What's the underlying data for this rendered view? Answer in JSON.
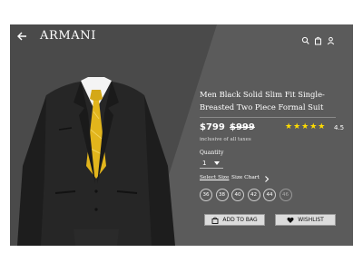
{
  "app": {
    "brand": "ARMANI",
    "icons": [
      "back-arrow-icon",
      "search-icon",
      "bag-icon",
      "user-icon"
    ]
  },
  "product": {
    "title": "Men Black Solid Slim Fit Single-Breasted Two Piece Formal Suit",
    "price": "$799",
    "mrp": "$999",
    "stars": "★★★★★",
    "rating": "4.5",
    "tax_note": "inclusive of all taxes",
    "quantity_label": "Quantity",
    "quantity_value": "1",
    "select_size_label": "Select Size",
    "size_chart_label": "Size Chart",
    "sizes": [
      "36",
      "38",
      "40",
      "42",
      "44",
      "46"
    ],
    "unavailable_sizes": [
      "46"
    ],
    "add_to_bag": "ADD TO BAG",
    "wishlist": "WISHLIST"
  },
  "colors": {
    "background": "#5b5b5b",
    "star": "#ffdd00",
    "button": "#dcdcdc"
  }
}
